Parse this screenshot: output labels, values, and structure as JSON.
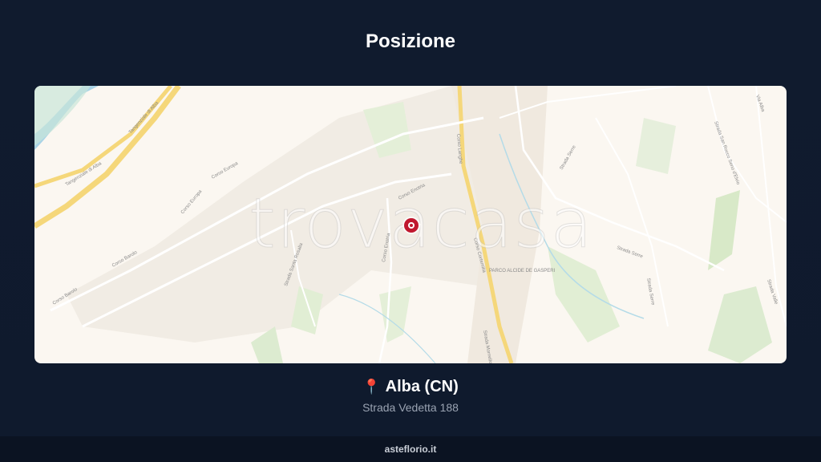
{
  "title": "Posizione",
  "map": {
    "watermark": "trovacasa",
    "marker_color": "#c0172e",
    "street_labels": [
      "Tangenziale di Alba",
      "Tangenziale di Alba",
      "Corso Europa",
      "Corso Europa",
      "Corso Barolo",
      "Corso Barolo",
      "Corso Enotria",
      "Corso Enotria",
      "Corso Langhe",
      "Corso Cortemilia",
      "Strada Santa Rosalia",
      "PARCO ALCIDE DE GASPERI",
      "Strada Serre",
      "Strada Serre",
      "Strada Serre",
      "Strada San Rocco Seno d'Elvio",
      "Via Alba",
      "Strada Mornello",
      "Strada Valle"
    ]
  },
  "location": {
    "icon": "map-pin-icon",
    "city": "Alba (CN)",
    "address": "Strada Vedetta 188"
  },
  "footer": {
    "site": "asteflorio.it"
  }
}
